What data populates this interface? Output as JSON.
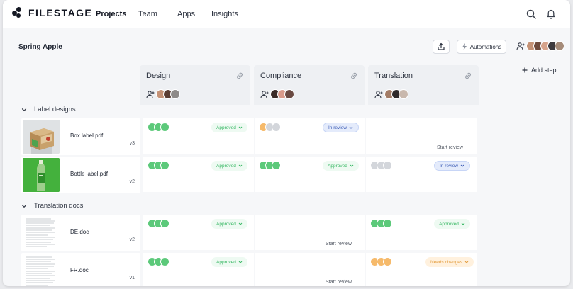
{
  "nav": {
    "brand": "FILESTAGE",
    "links": [
      "Projects",
      "Team",
      "Apps",
      "Insights"
    ],
    "active": "Projects"
  },
  "project": {
    "title": "Spring Apple",
    "automations_label": "Automations",
    "add_step_label": "Add step"
  },
  "steps": [
    {
      "name": "Design"
    },
    {
      "name": "Compliance"
    },
    {
      "name": "Translation"
    }
  ],
  "groups": [
    {
      "title": "Label designs",
      "files": [
        {
          "name": "Box label.pdf",
          "version": "v3",
          "cells": [
            {
              "status": "Approved",
              "action": ""
            },
            {
              "status": "In review",
              "action": ""
            },
            {
              "status": "",
              "action": "Start review"
            }
          ]
        },
        {
          "name": "Bottle label.pdf",
          "version": "v2",
          "cells": [
            {
              "status": "Approved",
              "action": ""
            },
            {
              "status": "Approved",
              "action": ""
            },
            {
              "status": "In review",
              "action": ""
            }
          ]
        }
      ]
    },
    {
      "title": "Translation docs",
      "files": [
        {
          "name": "DE.doc",
          "version": "v2",
          "cells": [
            {
              "status": "Approved",
              "action": ""
            },
            {
              "status": "",
              "action": "Start review"
            },
            {
              "status": "Approved",
              "action": ""
            }
          ]
        },
        {
          "name": "FR.doc",
          "version": "v1",
          "cells": [
            {
              "status": "Approved",
              "action": ""
            },
            {
              "status": "",
              "action": "Start review"
            },
            {
              "status": "Needs changes",
              "action": ""
            }
          ]
        }
      ]
    }
  ],
  "colors": {
    "approved": "#5cc97a",
    "in_review": "#3b5bb5",
    "needs_changes": "#f6ba6b",
    "pending": "#d3d6db"
  }
}
